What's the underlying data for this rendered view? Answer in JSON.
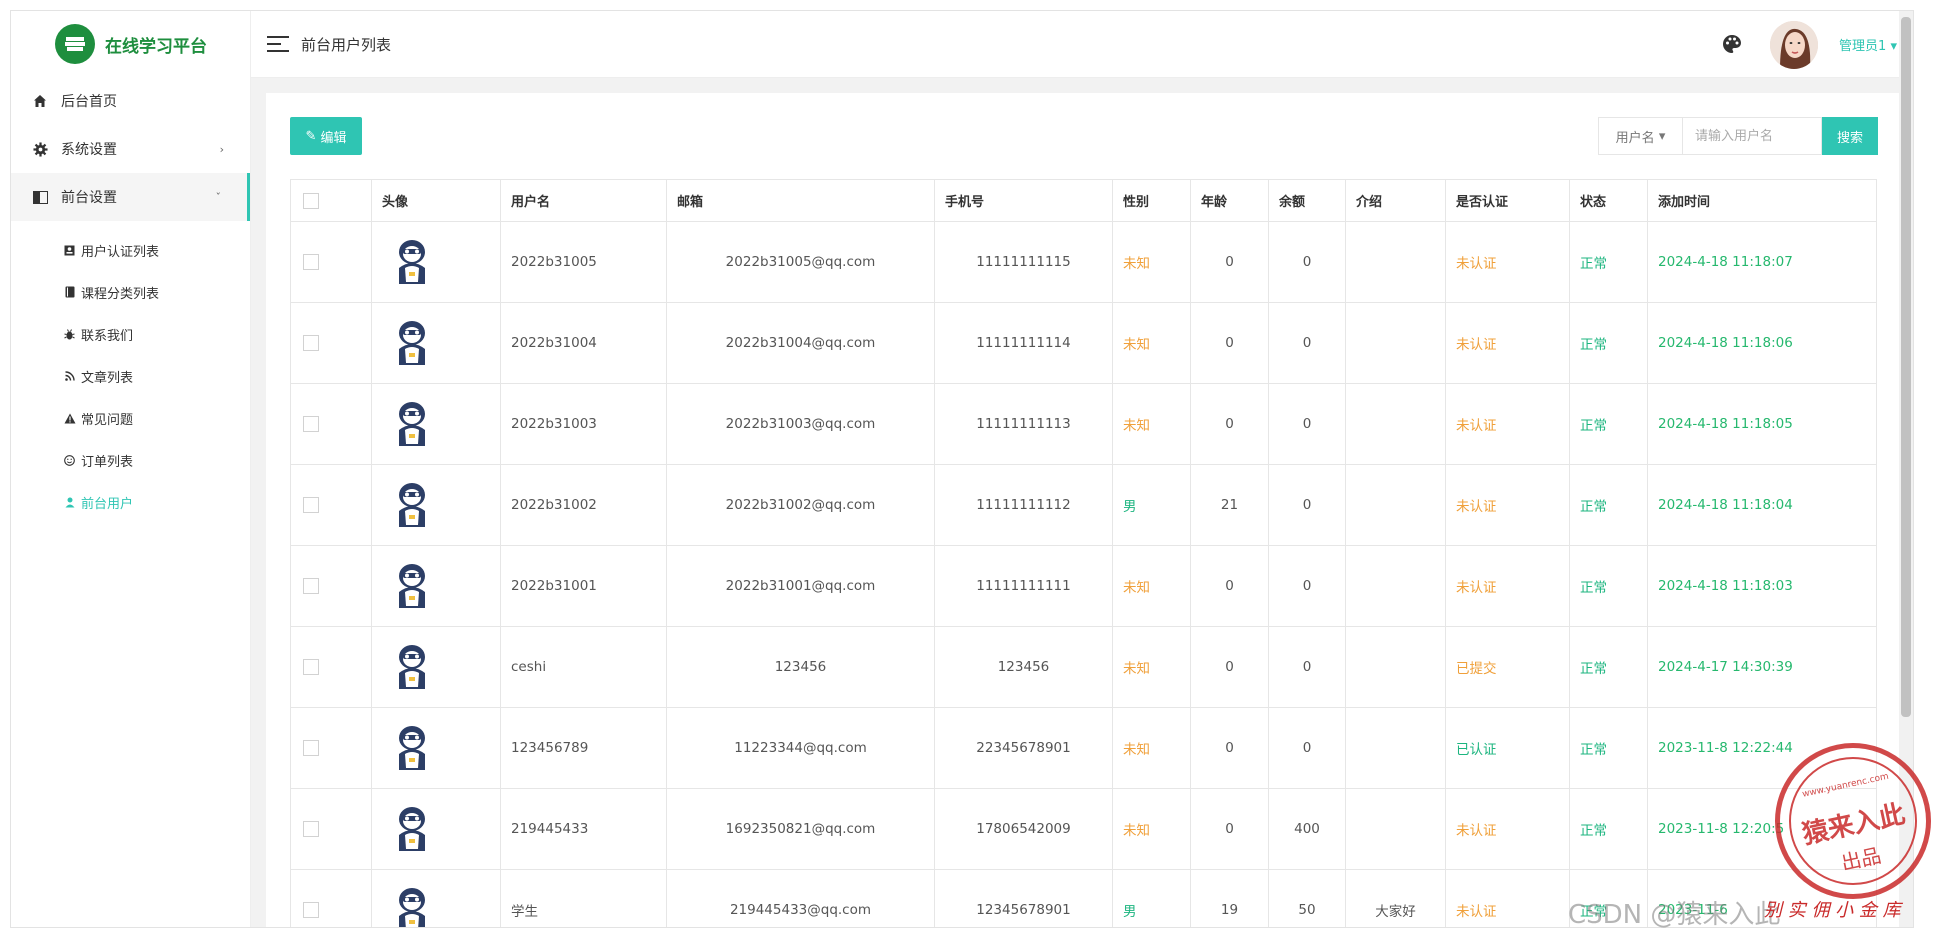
{
  "app": {
    "title": "在线学习平台"
  },
  "sidebar": {
    "items": [
      {
        "label": "后台首页",
        "icon": "home-icon"
      },
      {
        "label": "系统设置",
        "icon": "gear-icon"
      },
      {
        "label": "前台设置",
        "icon": "panel-icon"
      }
    ],
    "sub_items": [
      {
        "label": "用户认证列表",
        "icon": "id-card-icon"
      },
      {
        "label": "课程分类列表",
        "icon": "book-icon"
      },
      {
        "label": "联系我们",
        "icon": "bug-icon"
      },
      {
        "label": "文章列表",
        "icon": "rss-icon"
      },
      {
        "label": "常见问题",
        "icon": "warning-icon"
      },
      {
        "label": "订单列表",
        "icon": "smile-icon"
      },
      {
        "label": "前台用户",
        "icon": "user-icon"
      }
    ]
  },
  "header": {
    "title": "前台用户列表",
    "admin": "管理员1"
  },
  "toolbar": {
    "edit_label": "编辑",
    "search_type": "用户名",
    "search_placeholder": "请输入用户名",
    "search_label": "搜索"
  },
  "table": {
    "headers": [
      "头像",
      "用户名",
      "邮箱",
      "手机号",
      "性别",
      "年龄",
      "余额",
      "介绍",
      "是否认证",
      "状态",
      "添加时间"
    ],
    "rows": [
      {
        "username": "2022b31005",
        "email": "2022b31005@qq.com",
        "phone": "11111111115",
        "gender": "未知",
        "age": "0",
        "balance": "0",
        "intro": "",
        "verified": "未认证",
        "status": "正常",
        "time": "2024-4-18 11:18:07"
      },
      {
        "username": "2022b31004",
        "email": "2022b31004@qq.com",
        "phone": "11111111114",
        "gender": "未知",
        "age": "0",
        "balance": "0",
        "intro": "",
        "verified": "未认证",
        "status": "正常",
        "time": "2024-4-18 11:18:06"
      },
      {
        "username": "2022b31003",
        "email": "2022b31003@qq.com",
        "phone": "11111111113",
        "gender": "未知",
        "age": "0",
        "balance": "0",
        "intro": "",
        "verified": "未认证",
        "status": "正常",
        "time": "2024-4-18 11:18:05"
      },
      {
        "username": "2022b31002",
        "email": "2022b31002@qq.com",
        "phone": "11111111112",
        "gender": "男",
        "age": "21",
        "balance": "0",
        "intro": "",
        "verified": "未认证",
        "status": "正常",
        "time": "2024-4-18 11:18:04"
      },
      {
        "username": "2022b31001",
        "email": "2022b31001@qq.com",
        "phone": "11111111111",
        "gender": "未知",
        "age": "0",
        "balance": "0",
        "intro": "",
        "verified": "未认证",
        "status": "正常",
        "time": "2024-4-18 11:18:03"
      },
      {
        "username": "ceshi",
        "email": "123456",
        "phone": "123456",
        "gender": "未知",
        "age": "0",
        "balance": "0",
        "intro": "",
        "verified": "已提交",
        "status": "正常",
        "time": "2024-4-17 14:30:39"
      },
      {
        "username": "123456789",
        "email": "11223344@qq.com",
        "phone": "22345678901",
        "gender": "未知",
        "age": "0",
        "balance": "0",
        "intro": "",
        "verified": "已认证",
        "status": "正常",
        "time": "2023-11-8 12:22:44"
      },
      {
        "username": "219445433",
        "email": "1692350821@qq.com",
        "phone": "17806542009",
        "gender": "未知",
        "age": "0",
        "balance": "400",
        "intro": "",
        "verified": "未认证",
        "status": "正常",
        "time": "2023-11-8 12:20:5"
      },
      {
        "username": "学生",
        "email": "219445433@qq.com",
        "phone": "12345678901",
        "gender": "男",
        "age": "19",
        "balance": "50",
        "intro": "大家好",
        "verified": "未认证",
        "status": "正常",
        "time": "2023-11-6"
      }
    ]
  },
  "stamp": {
    "url": "www.yuanrenc.com",
    "line1": "猿来入此",
    "line2": "出品"
  },
  "watermark": {
    "text": "CSDN @猿来入此",
    "red_text": "别 实 佣 小 金 库"
  },
  "colors": {
    "accent": "#2fc5b3",
    "warn": "#f0a03a",
    "ok": "#1cb57f",
    "brand": "#1e8e3e"
  }
}
